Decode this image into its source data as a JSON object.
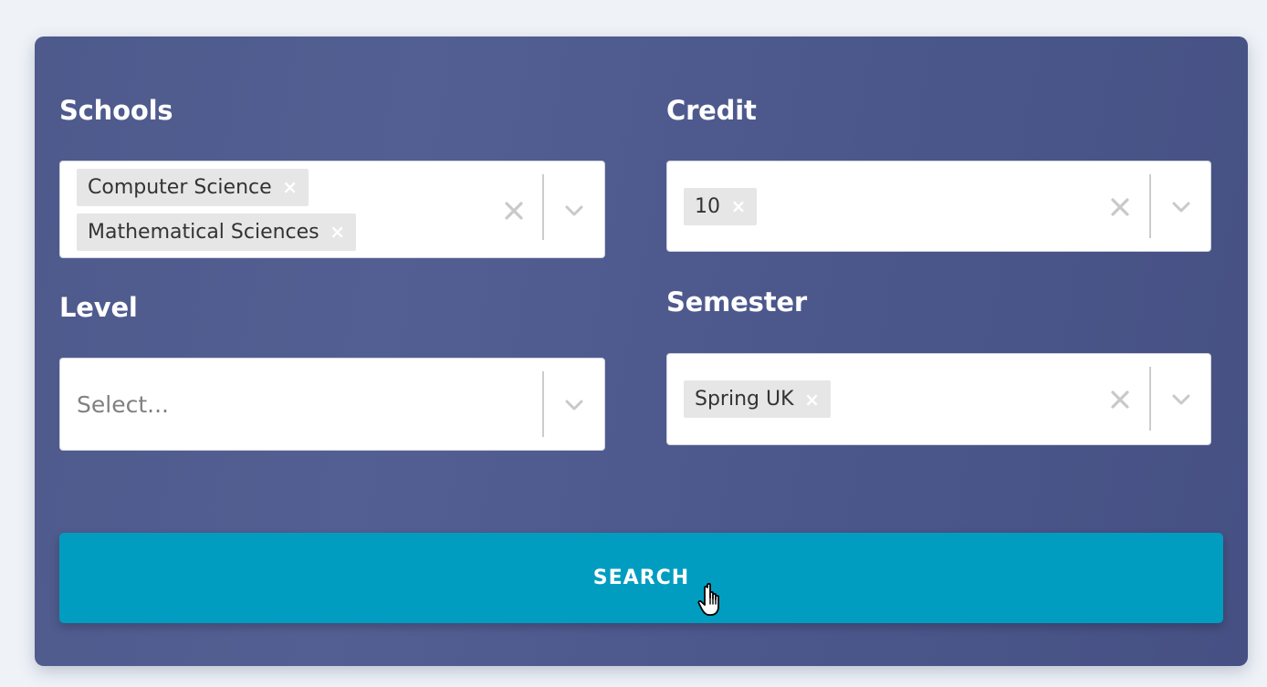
{
  "filters": {
    "schools": {
      "label": "Schools",
      "selected": [
        "Computer Science",
        "Mathematical Sciences"
      ],
      "remove_glyph": "×"
    },
    "credit": {
      "label": "Credit",
      "selected": [
        "10"
      ],
      "remove_glyph": "×"
    },
    "level": {
      "label": "Level",
      "placeholder": "Select..."
    },
    "semester": {
      "label": "Semester",
      "selected": [
        "Spring UK"
      ],
      "remove_glyph": "×"
    }
  },
  "search_button": {
    "label": "SEARCH"
  },
  "icons": {
    "clear": "clear-x-icon",
    "dropdown": "chevron-down-icon",
    "cursor": "hand-pointer-icon"
  },
  "colors": {
    "panel": "#4e5a8c",
    "button": "#009dc1",
    "chip": "#e6e6e6",
    "page_background": "#eff3f8"
  }
}
